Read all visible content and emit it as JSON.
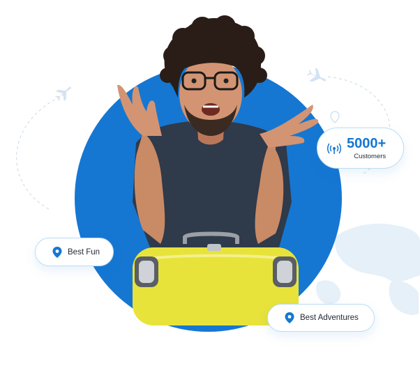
{
  "badges": {
    "customers": {
      "count": "5000+",
      "label": "Customers",
      "icon": "signal-icon"
    },
    "best_fun": {
      "label": "Best Fun",
      "icon": "location-pin-icon"
    },
    "best_adventures": {
      "label": "Best Adventures",
      "icon": "location-pin-icon"
    }
  },
  "colors": {
    "accent": "#1577d2",
    "suitcase": "#e8e33a",
    "shirt": "#2f3a4a",
    "skin": "#c98a66",
    "hair": "#2a1d17"
  }
}
